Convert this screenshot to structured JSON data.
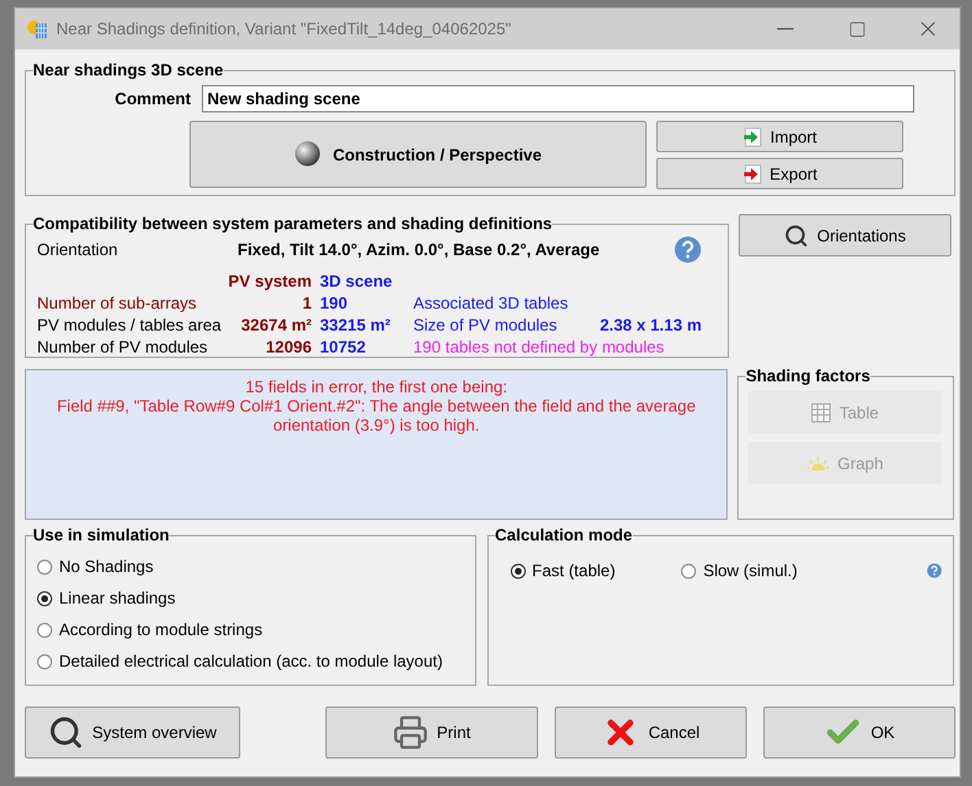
{
  "window": {
    "title": "Near Shadings definition, Variant \"FixedTilt_14deg_04062025\""
  },
  "scene": {
    "title": "Near shadings 3D scene",
    "comment_label": "Comment",
    "comment_value": "New shading scene",
    "construction_button": "Construction / Perspective",
    "import_button": "Import",
    "export_button": "Export"
  },
  "compatibility": {
    "title": "Compatibility between system parameters and shading definitions",
    "orientation_label": "Orientation",
    "orientation_value": "Fixed, Tilt 14.0°, Azim. 0.0°, Base 0.2°, Average",
    "column_headers": [
      "PV system",
      "3D scene"
    ],
    "rows": [
      {
        "label": "Number of sub-arrays",
        "emphasis": true,
        "pv_system": "1",
        "scene": "190",
        "note": {
          "text": "Associated 3D tables",
          "color": "#1a1aee"
        }
      },
      {
        "label": "PV modules / tables area",
        "emphasis": false,
        "pv_system": "32674 m²",
        "scene": "33215 m²",
        "note": {
          "text": "Size of PV modules",
          "color": "#1a1aee",
          "value": "2.38 x 1.13 m"
        }
      },
      {
        "label": "Number of PV modules",
        "emphasis": false,
        "pv_system": "12096",
        "scene": "10752",
        "note": {
          "text": "190 tables not defined by modules",
          "color": "#ee22ee"
        }
      }
    ]
  },
  "orientations_button": "Orientations",
  "error_messages": [
    "15 fields in error, the first one being:",
    "Field ##9, \"Table Row#9 Col#1 Orient.#2\": The angle between the field and the average orientation (3.9°) is too high."
  ],
  "shading_factors": {
    "title": "Shading factors",
    "buttons": [
      {
        "label": "Table",
        "kind": "table",
        "disabled": true
      },
      {
        "label": "Graph",
        "kind": "graph",
        "disabled": true
      }
    ]
  },
  "use_in_simulation": {
    "title": "Use in simulation",
    "options": [
      {
        "label": "No Shadings",
        "selected": false
      },
      {
        "label": "Linear shadings",
        "selected": true
      },
      {
        "label": "According to module strings",
        "selected": false
      },
      {
        "label": "Detailed electrical calculation (acc. to module layout)",
        "selected": false
      }
    ]
  },
  "calculation_mode": {
    "title": "Calculation mode",
    "options": [
      {
        "label": "Fast (table)",
        "selected": true
      },
      {
        "label": "Slow (simul.)",
        "selected": false
      }
    ]
  },
  "bottom_buttons": [
    {
      "label": "System overview",
      "kind": "overview"
    },
    {
      "label": "Print",
      "kind": "print"
    },
    {
      "label": "Cancel",
      "kind": "cancel"
    },
    {
      "label": "OK",
      "kind": "ok"
    }
  ]
}
